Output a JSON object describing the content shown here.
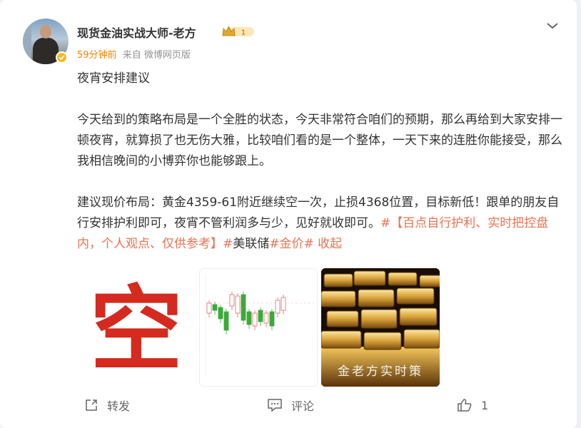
{
  "post": {
    "author": "现货金油实战大师-老方",
    "time": "59分钟前",
    "source": "来自 微博网页版",
    "title": "夜宵安排建议",
    "para1": "今天给到的策略布局是一个全胜的状态，今天非常符合咱们的预期，那么再给到大家安排一顿夜宵，就算损了也无伤大雅，比较咱们看的是一个整体，一天下来的连胜你能接受，那么我相信晚间的小博弈你也能够跟上。",
    "para2_text": "建议现价布局：黄金4359-61附近继续空一次，止损4368位置，目标新低！跟单的朋友自行安排护利即可，夜宵不管利润多与少，见好就收即可。",
    "tag1": "#【百点自行护利、实时把控盘内，个人观点、仅供参考】#",
    "tag2": "美联储",
    "tag3": "#金价#",
    "collapse": "收起",
    "image1_char": "空",
    "image3_caption": "金老方实时策"
  },
  "actions": {
    "repost": "转发",
    "comment": "评论",
    "like_count": "1"
  },
  "badge": {
    "level": "1",
    "accent": "#f8b81f"
  },
  "colors": {
    "time": "#ff8200",
    "tag": "#eb7350",
    "text": "#333333",
    "meta": "#939393"
  }
}
